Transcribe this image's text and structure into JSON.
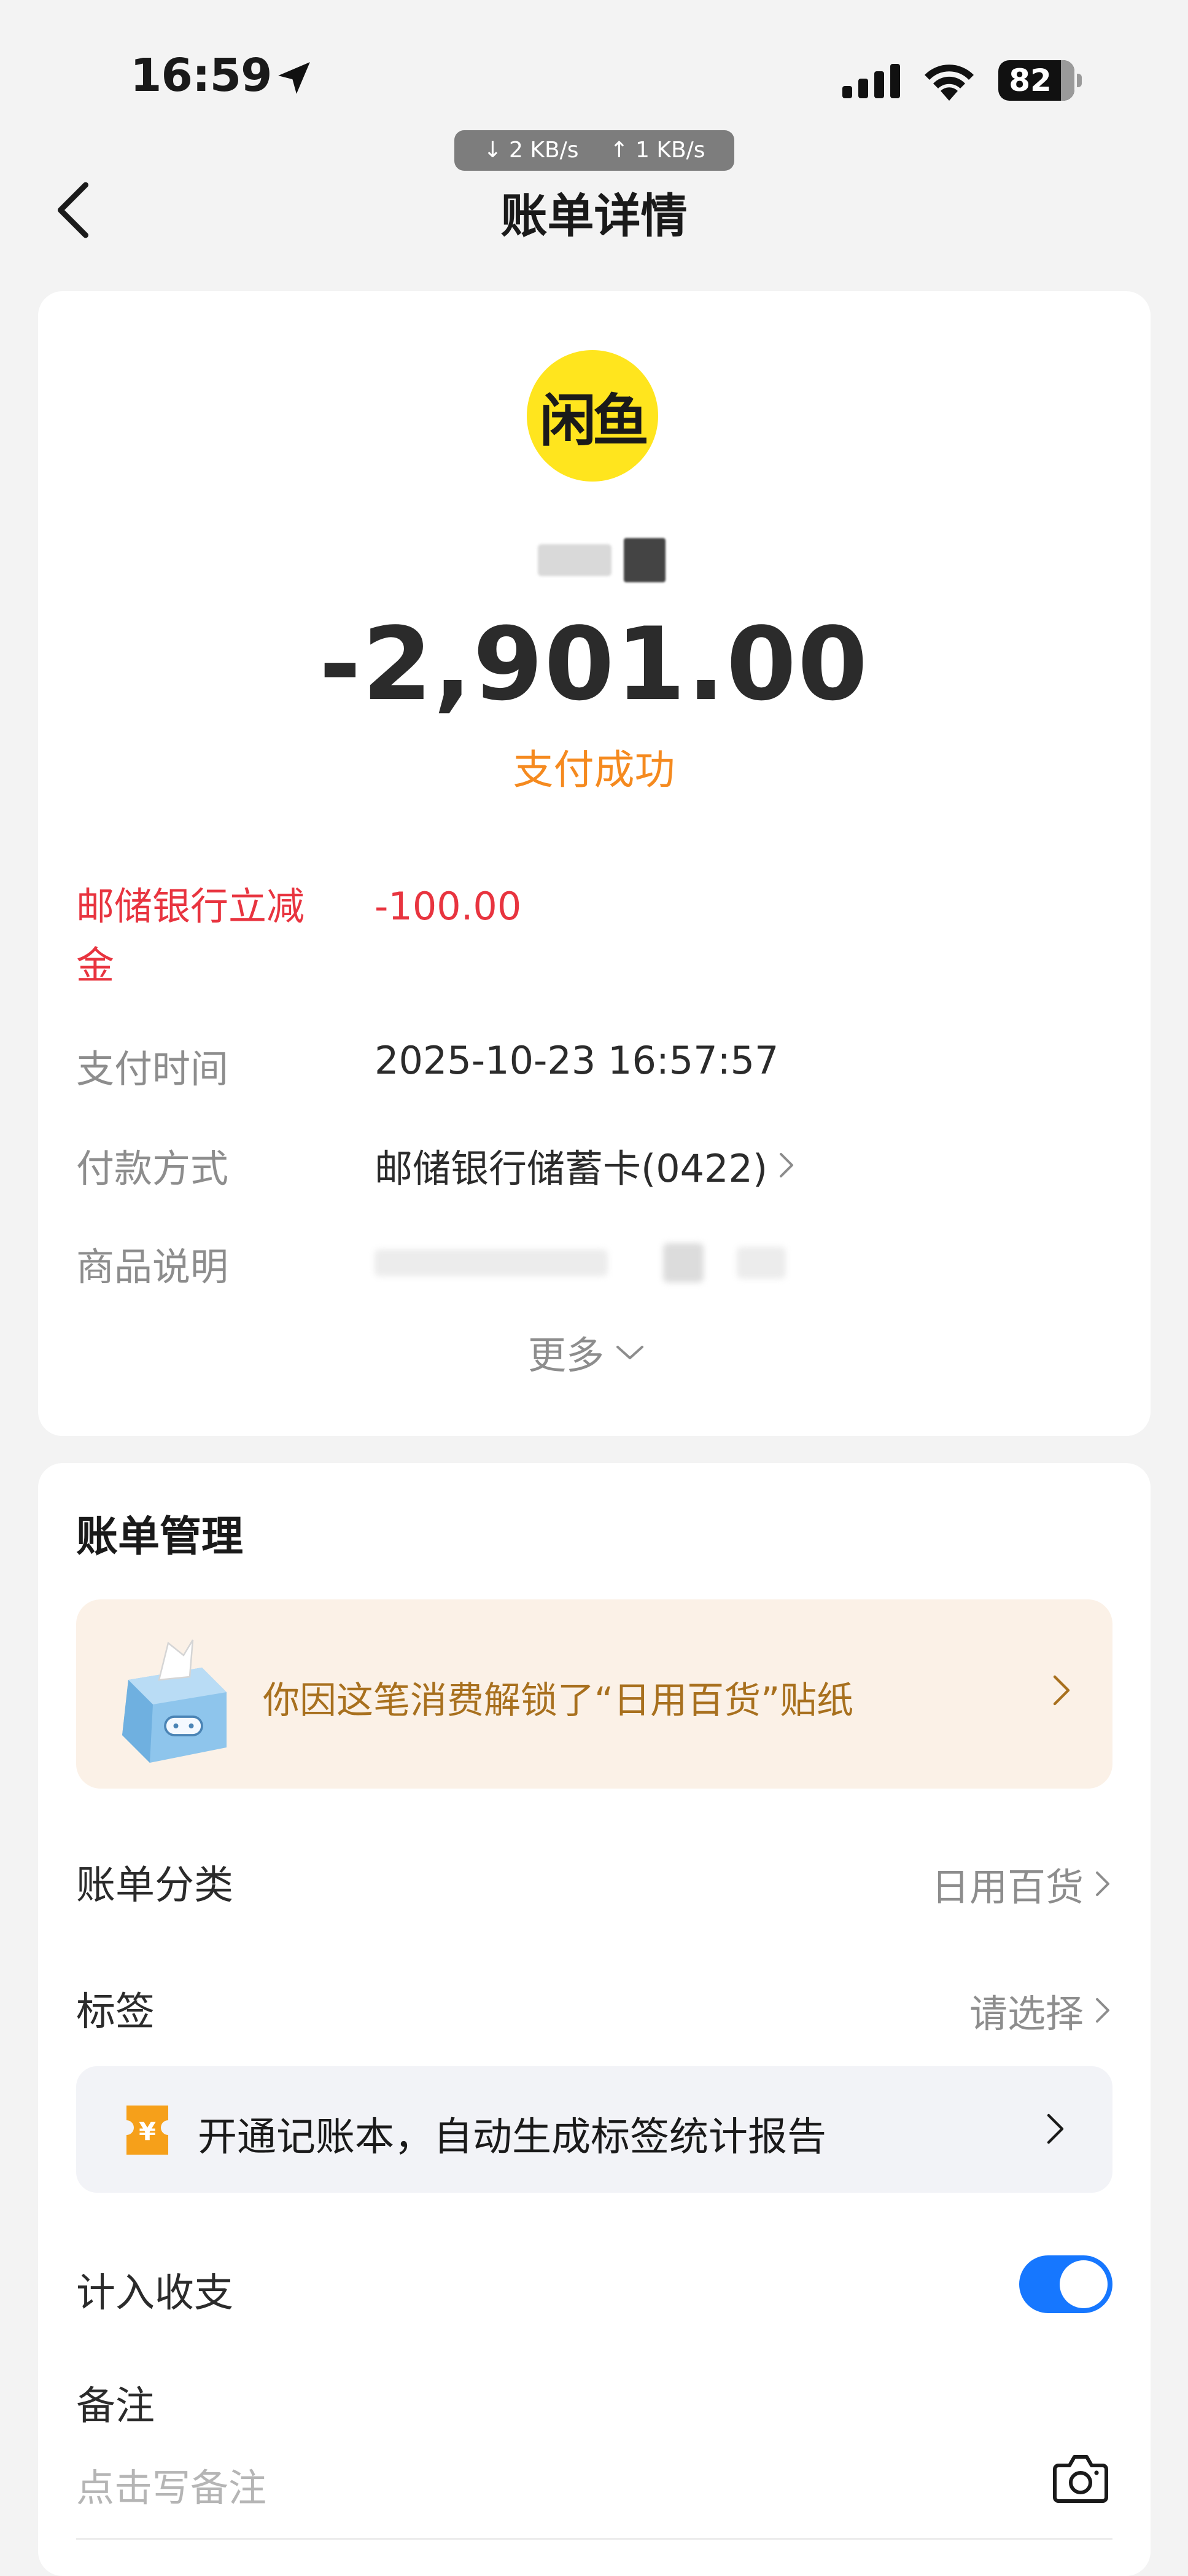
{
  "status_bar": {
    "time": "16:59",
    "battery": "82",
    "net_down": "↓ 2 KB/s",
    "net_up": "↑ 1 KB/s"
  },
  "nav": {
    "title": "账单详情",
    "back_icon": "chevron-left-icon"
  },
  "summary": {
    "merchant_logo_text": "闲鱼",
    "merchant_logo_color": "#ffe51e",
    "amount": "-2,901.00",
    "status": "支付成功",
    "status_color": "#f58a1f"
  },
  "details": {
    "discount_label": "邮储银行立减金",
    "discount_value": "-100.00",
    "discount_color": "#e8343f",
    "time_label": "支付时间",
    "time_value": "2025-10-23 16:57:57",
    "method_label": "付款方式",
    "method_value": "邮储银行储蓄卡(0422)",
    "goods_label": "商品说明",
    "more_label": "更多"
  },
  "management": {
    "title": "账单管理",
    "sticker_text": "你因这笔消费解锁了“日用百货”贴纸",
    "category_label": "账单分类",
    "category_value": "日用百货",
    "tag_label": "标签",
    "tag_value": "请选择",
    "promo_icon_text": "¥",
    "promo_text": "开通记账本，自动生成标签统计报告",
    "income_label": "计入收支",
    "income_toggle_on": true,
    "toggle_color": "#1677ff",
    "note_label": "备注",
    "note_placeholder": "点击写备注"
  }
}
